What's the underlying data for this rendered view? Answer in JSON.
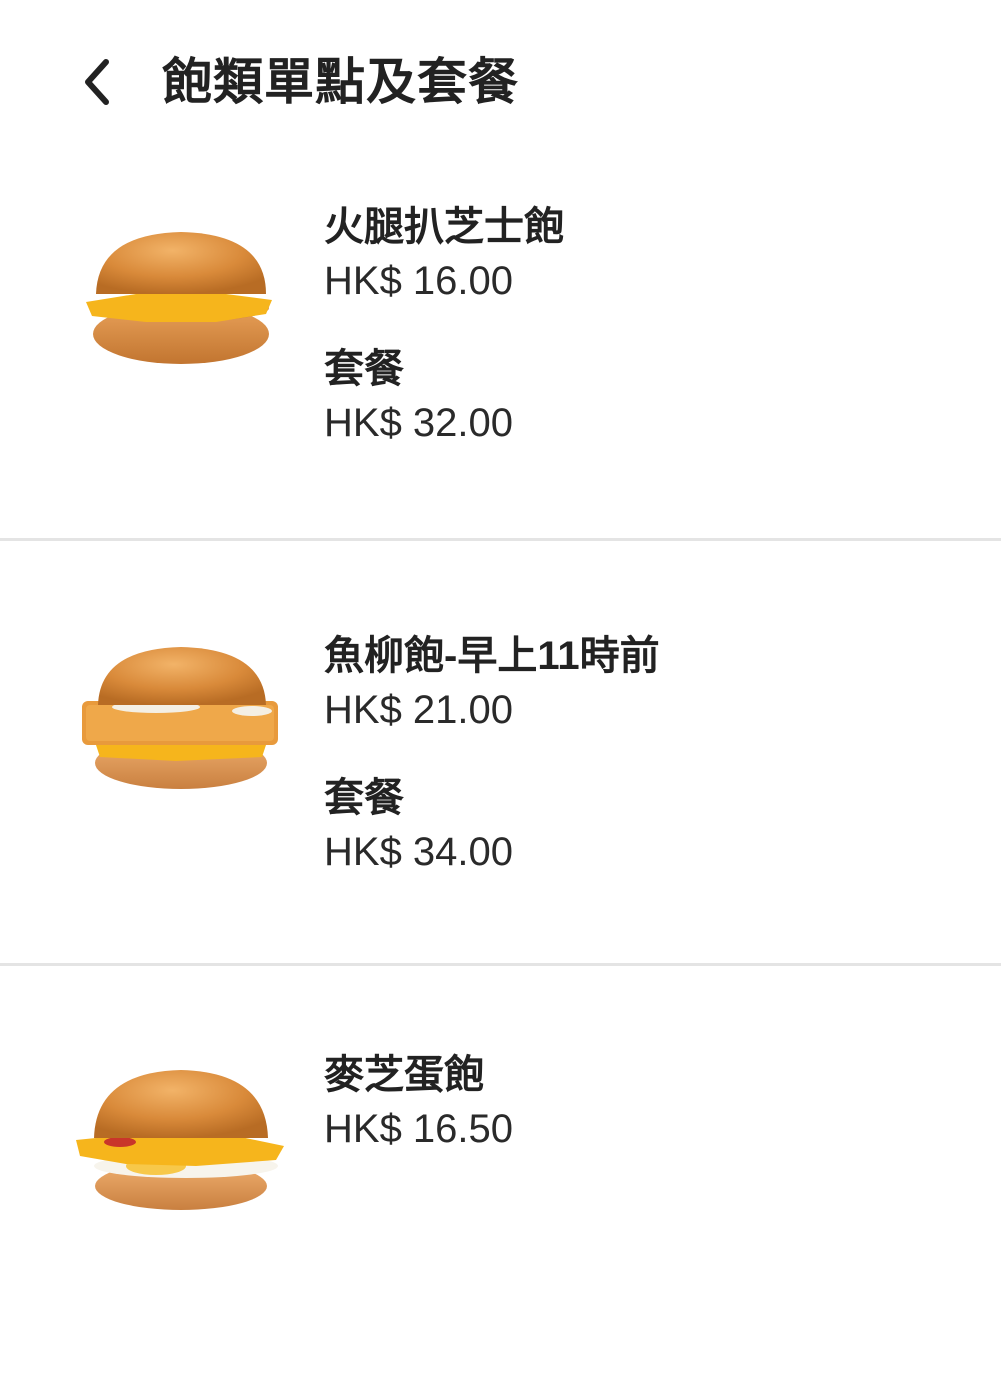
{
  "header": {
    "title": "飽類單點及套餐",
    "back_icon": "chevron-left-icon"
  },
  "items": [
    {
      "name": "火腿扒芝士飽",
      "price": "HK$ 16.00",
      "combo_label": "套餐",
      "combo_price": "HK$ 32.00",
      "image": "ham-cheese-burger-image"
    },
    {
      "name": "魚柳飽-早上11時前",
      "price": "HK$ 21.00",
      "combo_label": "套餐",
      "combo_price": "HK$ 34.00",
      "image": "filet-o-fish-image"
    },
    {
      "name": "麥芝蛋飽",
      "price": "HK$ 16.50",
      "image": "egg-cheese-burger-image"
    }
  ],
  "colors": {
    "text": "#222222",
    "divider": "#e4e4e4",
    "bun": "#d98a3a",
    "cheese": "#f6b51c"
  }
}
